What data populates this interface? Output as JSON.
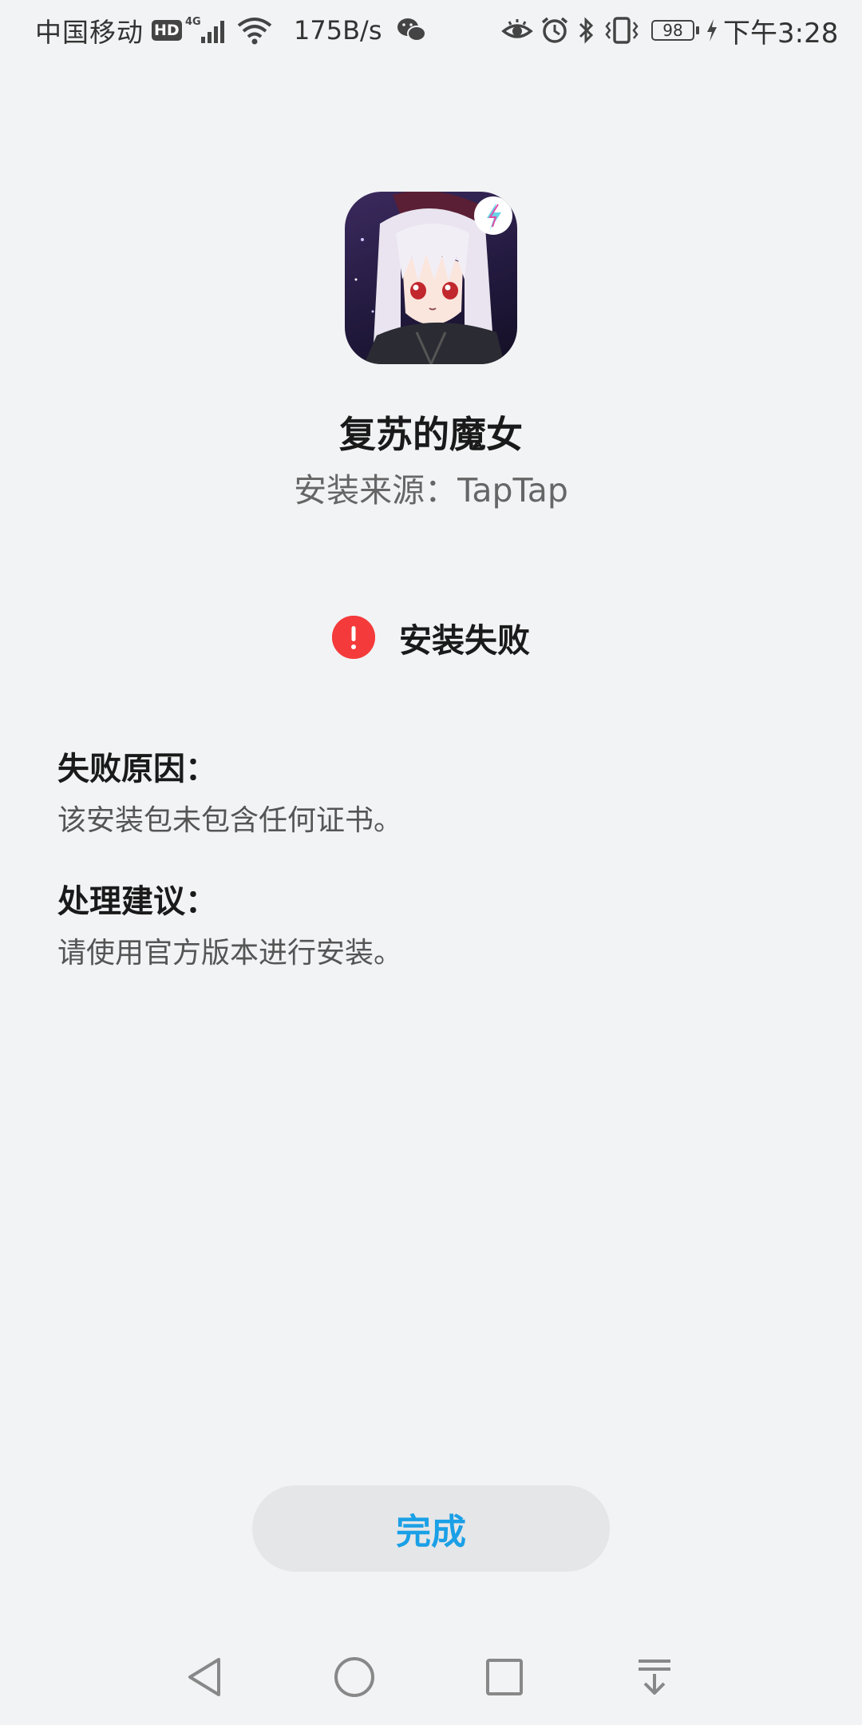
{
  "status_bar": {
    "carrier": "中国移动",
    "hd": "HD",
    "network": "4G",
    "speed": "175B/s",
    "battery": "98",
    "time": "下午3:28"
  },
  "app": {
    "name": "复苏的魔女",
    "source": "安装来源：TapTap"
  },
  "result": {
    "status": "安装失败",
    "icon": "error-icon",
    "color": "#f43a3a"
  },
  "details": {
    "reason_title": "失败原因：",
    "reason_text": "该安装包未包含任何证书。",
    "suggestion_title": "处理建议：",
    "suggestion_text": "请使用官方版本进行安装。"
  },
  "actions": {
    "done_label": "完成",
    "accent": "#1aa0e6"
  },
  "nav_bar": {
    "icons": [
      "back-icon",
      "home-icon",
      "recents-icon",
      "notification-pulldown-icon"
    ]
  }
}
